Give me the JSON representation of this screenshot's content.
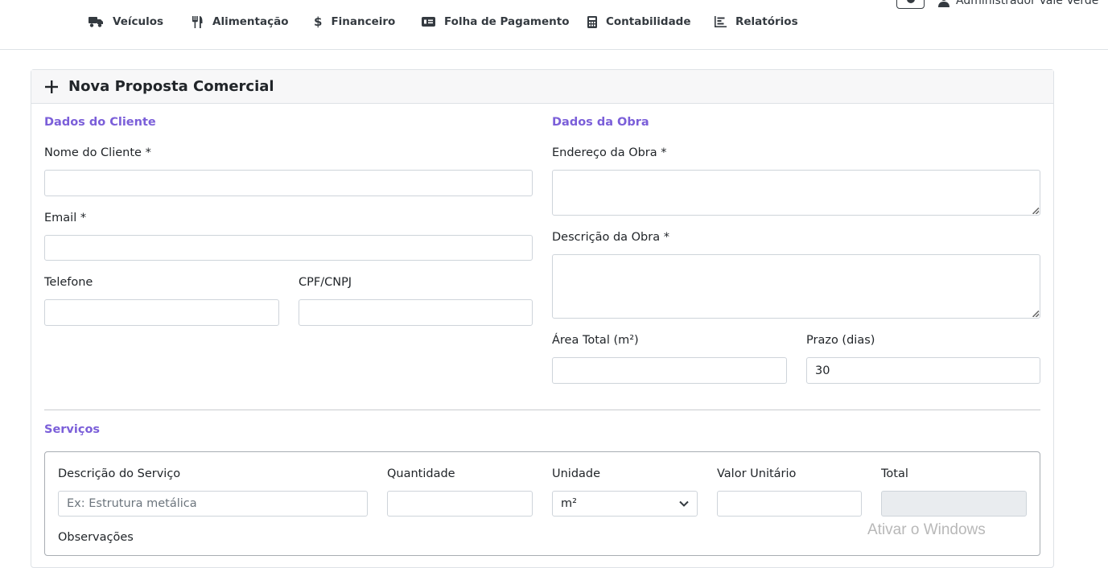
{
  "nav": {
    "items": [
      {
        "label": "Veículos",
        "icon": "truck-icon"
      },
      {
        "label": "Alimentação",
        "icon": "utensils-icon"
      },
      {
        "label": "Financeiro",
        "icon": "dollar-icon"
      },
      {
        "label": "Folha de Pagamento",
        "icon": "money-check-icon"
      },
      {
        "label": "Contabilidade",
        "icon": "calculator-icon"
      },
      {
        "label": "Relatórios",
        "icon": "bar-chart-icon"
      }
    ],
    "user_name": "Administrador Vale Verde"
  },
  "card": {
    "title": "Nova Proposta Comercial"
  },
  "client": {
    "section_title": "Dados do Cliente",
    "name_label": "Nome do Cliente *",
    "name_value": "",
    "email_label": "Email *",
    "email_value": "",
    "phone_label": "Telefone",
    "phone_value": "",
    "doc_label": "CPF/CNPJ",
    "doc_value": ""
  },
  "work": {
    "section_title": "Dados da Obra",
    "address_label": "Endereço da Obra *",
    "address_value": "",
    "description_label": "Descrição da Obra *",
    "description_value": "",
    "area_label": "Área Total (m²)",
    "area_value": "",
    "deadline_label": "Prazo (dias)",
    "deadline_value": "30"
  },
  "services": {
    "section_title": "Serviços",
    "description_label": "Descrição do Serviço",
    "description_placeholder": "Ex: Estrutura metálica",
    "quantity_label": "Quantidade",
    "quantity_value": "",
    "unit_label": "Unidade",
    "unit_selected": "m²",
    "unit_price_label": "Valor Unitário",
    "unit_price_value": "",
    "total_label": "Total",
    "total_value": "",
    "notes_label": "Observações"
  },
  "watermark": "Ativar o Windows",
  "colors": {
    "section_accent": "#7b5fd9",
    "border": "#ced4da",
    "header_bg": "#f7f7f8"
  }
}
